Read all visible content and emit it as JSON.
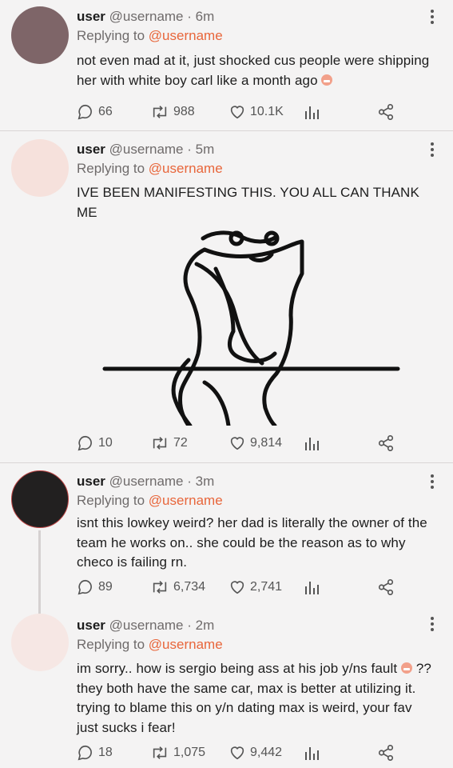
{
  "tweets": [
    {
      "user": "user",
      "handle": "@username",
      "time": "· 6m",
      "replying_prefix": "Replying to",
      "replying_to": "@username",
      "text": "not even mad at it, just shocked cus people were shipping her with white boy carl like a month ago",
      "emoji": "grimacing-face",
      "replies": "66",
      "retweets": "988",
      "likes": "10.1K",
      "avatar_color": "#7e6568"
    },
    {
      "user": "user",
      "handle": "@username",
      "time": "· 5m",
      "replying_prefix": "Replying to",
      "replying_to": "@username",
      "text": "IVE BEEN MANIFESTING THIS. YOU ALL CAN THANK ME",
      "replies": "10",
      "retweets": "72",
      "likes": "9,814",
      "avatar_color": "#f6e1dc"
    },
    {
      "user": "user",
      "handle": "@username",
      "time": "· 3m",
      "replying_prefix": "Replying to",
      "replying_to": "@username",
      "text": "isnt this lowkey weird? her dad is literally the owner of the team he works on.. she could be the reason as to why checo is failing rn.",
      "replies": "89",
      "retweets": "6,734",
      "likes": "2,741",
      "avatar_color": "#222020"
    },
    {
      "user": "user",
      "handle": "@username",
      "time": "· 2m",
      "replying_prefix": "Replying to",
      "replying_to": "@username",
      "text_before_emoji": "im sorry.. how is sergio being ass at his job y/ns fault",
      "emoji": "grimacing-face",
      "text_after_emoji": "?? they both have the same car, max is better at utilizing it. trying to blame this on y/n dating max is weird, your fav just sucks i fear!",
      "replies": "18",
      "retweets": "1,075",
      "likes": "9,442",
      "avatar_color": "#f6e7e4"
    }
  ],
  "icons": {
    "reply": "speech-bubble-icon",
    "retweet": "retweet-icon",
    "like": "heart-icon",
    "analytics": "bar-chart-icon",
    "share": "share-icon",
    "more": "more-vertical-icon"
  },
  "colors": {
    "mention": "#e8663b",
    "background": "#f4f3f3"
  }
}
